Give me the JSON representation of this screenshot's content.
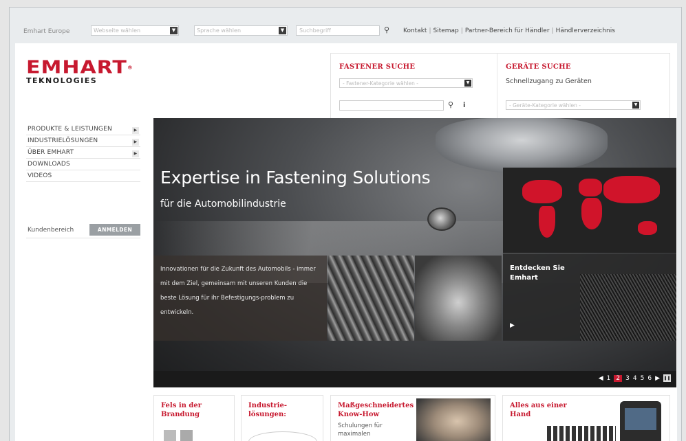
{
  "topbar": {
    "region": "Emhart Europe",
    "website_select": "Webseite wählen",
    "language_select": "Sprache wählen",
    "search_placeholder": "Suchbegriff",
    "links": [
      "Kontakt",
      "Sitemap",
      "Partner-Bereich für Händler",
      "Händlerverzeichnis"
    ]
  },
  "logo": {
    "line1": "EMHART",
    "line2": "TEKNOLOGIES"
  },
  "fastener": {
    "title": "FASTENER SUCHE",
    "category_select": "- Fastener-Kategorie wählen -"
  },
  "geraete": {
    "title": "GERÄTE SUCHE",
    "subtitle": "Schnellzugang zu Geräten",
    "category_select": "- Geräte-Kategorie wählen -"
  },
  "nav": [
    {
      "label": "PRODUKTE & LEISTUNGEN",
      "has_sub": true
    },
    {
      "label": "INDUSTRIELÖSUNGEN",
      "has_sub": true
    },
    {
      "label": "ÜBER EMHART",
      "has_sub": true
    },
    {
      "label": "DOWNLOADS",
      "has_sub": false
    },
    {
      "label": "VIDEOS",
      "has_sub": false
    }
  ],
  "kunden": {
    "label": "Kundenbereich",
    "button": "ANMELDEN"
  },
  "hero": {
    "title": "Expertise in Fastening Solutions",
    "subtitle": "für die Automobilindustrie",
    "blurb": "Innovationen für die Zukunft des Automobils - immer mit dem Ziel, gemeinsam mit unseren Kunden die beste Lösung für ihr Befestigungs-problem zu entwickeln.",
    "discover": "Entdecken Sie Emhart",
    "pager": [
      "1",
      "2",
      "3",
      "4",
      "5",
      "6"
    ],
    "active_page": "2"
  },
  "teasers": [
    {
      "title": "Fels in der Brandung",
      "sub": ""
    },
    {
      "title": "Industrie-lösungen:",
      "sub": ""
    },
    {
      "title": "Maßgeschneidertes Know-How",
      "sub": "Schulungen für maximalen"
    },
    {
      "title": "Alles aus einer Hand",
      "sub": ""
    }
  ],
  "colors": {
    "brand_red": "#c7192f",
    "dark": "#1a1a1a"
  },
  "icons": {
    "search": "search-icon",
    "info": "info-icon",
    "dropdown": "dropdown-arrow-icon",
    "nav_arrow": "chevron-right-icon"
  }
}
